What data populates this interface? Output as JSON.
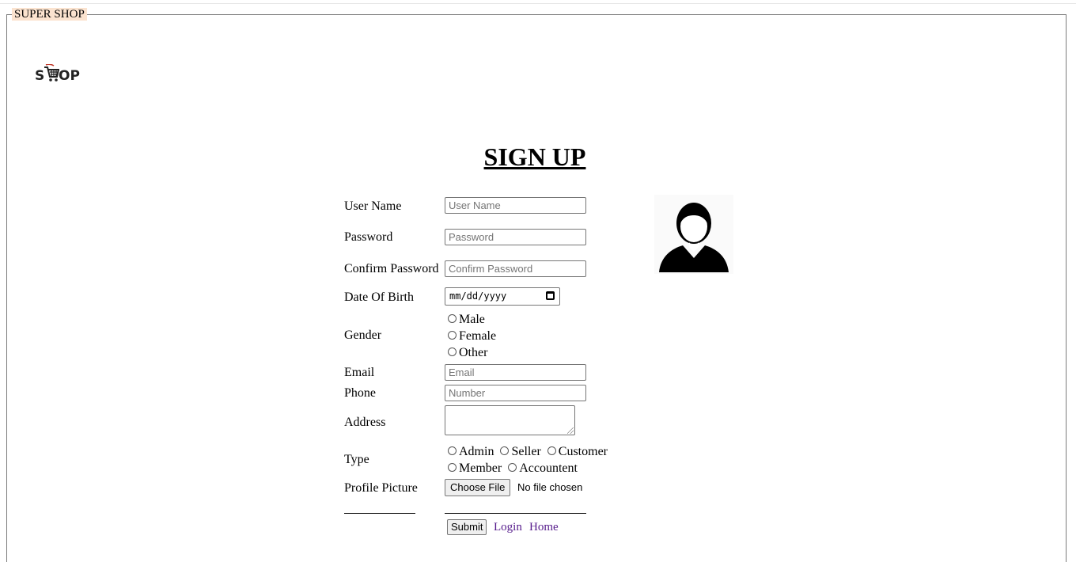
{
  "frame": {
    "legend": "SUPER SHOP"
  },
  "logo": {
    "text_left": "S",
    "text_right": "OP",
    "icon": "shopping-cart-icon",
    "accent": "#c0392b"
  },
  "page": {
    "title": "SIGN UP"
  },
  "form": {
    "username": {
      "label": "User Name",
      "placeholder": "User Name"
    },
    "password": {
      "label": "Password",
      "placeholder": "Password"
    },
    "confirm_password": {
      "label": "Confirm Password",
      "placeholder": "Confirm Password"
    },
    "dob": {
      "label": "Date Of Birth",
      "placeholder": "mm/dd/yyyy",
      "icon": "calendar-icon"
    },
    "gender": {
      "label": "Gender",
      "options": [
        "Male",
        "Female",
        "Other"
      ]
    },
    "email": {
      "label": "Email",
      "placeholder": "Email"
    },
    "phone": {
      "label": "Phone",
      "placeholder": "Number"
    },
    "address": {
      "label": "Address"
    },
    "type": {
      "label": "Type",
      "options": [
        "Admin",
        "Seller",
        "Customer",
        "Member",
        "Accountent"
      ]
    },
    "profile_picture": {
      "label": "Profile Picture",
      "button": "Choose File",
      "status": "No file chosen"
    },
    "submit_label": "Submit",
    "login_link": "Login",
    "home_link": "Home"
  },
  "avatar": {
    "icon": "user-avatar-icon"
  },
  "colors": {
    "legend_bg": "#fbe3cf",
    "link": "#551a8b"
  }
}
